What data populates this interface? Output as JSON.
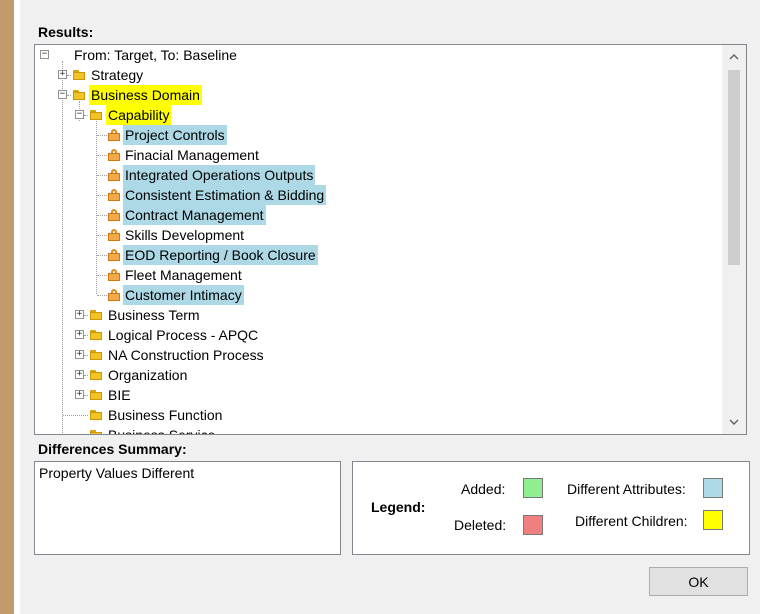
{
  "results_label": "Results:",
  "tree": {
    "root": {
      "label": "From: Target, To: Baseline",
      "expander": "−"
    },
    "items": [
      {
        "label": "Strategy",
        "expander": "+",
        "icon": "folder-icon"
      },
      {
        "label": "Business Domain",
        "expander": "−",
        "icon": "folder-icon",
        "highlight": "yellow"
      },
      {
        "label": "Capability",
        "expander": "−",
        "icon": "folder-icon",
        "highlight": "yellow"
      },
      {
        "label": "Project Controls",
        "icon": "capability-icon",
        "highlight": "blue"
      },
      {
        "label": "Finacial Management",
        "icon": "capability-icon"
      },
      {
        "label": "Integrated Operations Outputs",
        "icon": "capability-icon",
        "highlight": "blue"
      },
      {
        "label": "Consistent Estimation & Bidding",
        "icon": "capability-icon",
        "highlight": "blue"
      },
      {
        "label": "Contract Management",
        "icon": "capability-icon",
        "highlight": "blue"
      },
      {
        "label": "Skills Development",
        "icon": "capability-icon"
      },
      {
        "label": "EOD Reporting / Book Closure",
        "icon": "capability-icon",
        "highlight": "blue"
      },
      {
        "label": "Fleet Management",
        "icon": "capability-icon"
      },
      {
        "label": "Customer Intimacy",
        "icon": "capability-icon",
        "highlight": "blue"
      },
      {
        "label": "Business Term",
        "expander": "+",
        "icon": "folder-icon"
      },
      {
        "label": "Logical Process - APQC",
        "expander": "+",
        "icon": "folder-icon"
      },
      {
        "label": "NA Construction Process",
        "expander": "+",
        "icon": "folder-icon"
      },
      {
        "label": "Organization",
        "expander": "+",
        "icon": "folder-icon"
      },
      {
        "label": "BIE",
        "expander": "+",
        "icon": "folder-icon"
      },
      {
        "label": "Business Function",
        "icon": "folder-icon"
      },
      {
        "label": "Business Service",
        "icon": "folder-icon"
      }
    ]
  },
  "scrollbar": {
    "up_glyph": "^",
    "down_glyph": "v"
  },
  "summary_label": "Differences Summary:",
  "summary_text": "Property Values Different",
  "legend": {
    "title": "Legend:",
    "added_label": "Added:",
    "deleted_label": "Deleted:",
    "diff_attributes_label": "Different Attributes:",
    "diff_children_label": "Different Children:",
    "colors": {
      "added": "#90ee90",
      "deleted": "#f08080",
      "diff_attributes": "#add8e6",
      "diff_children": "#ffff00"
    }
  },
  "ok_label": "OK"
}
